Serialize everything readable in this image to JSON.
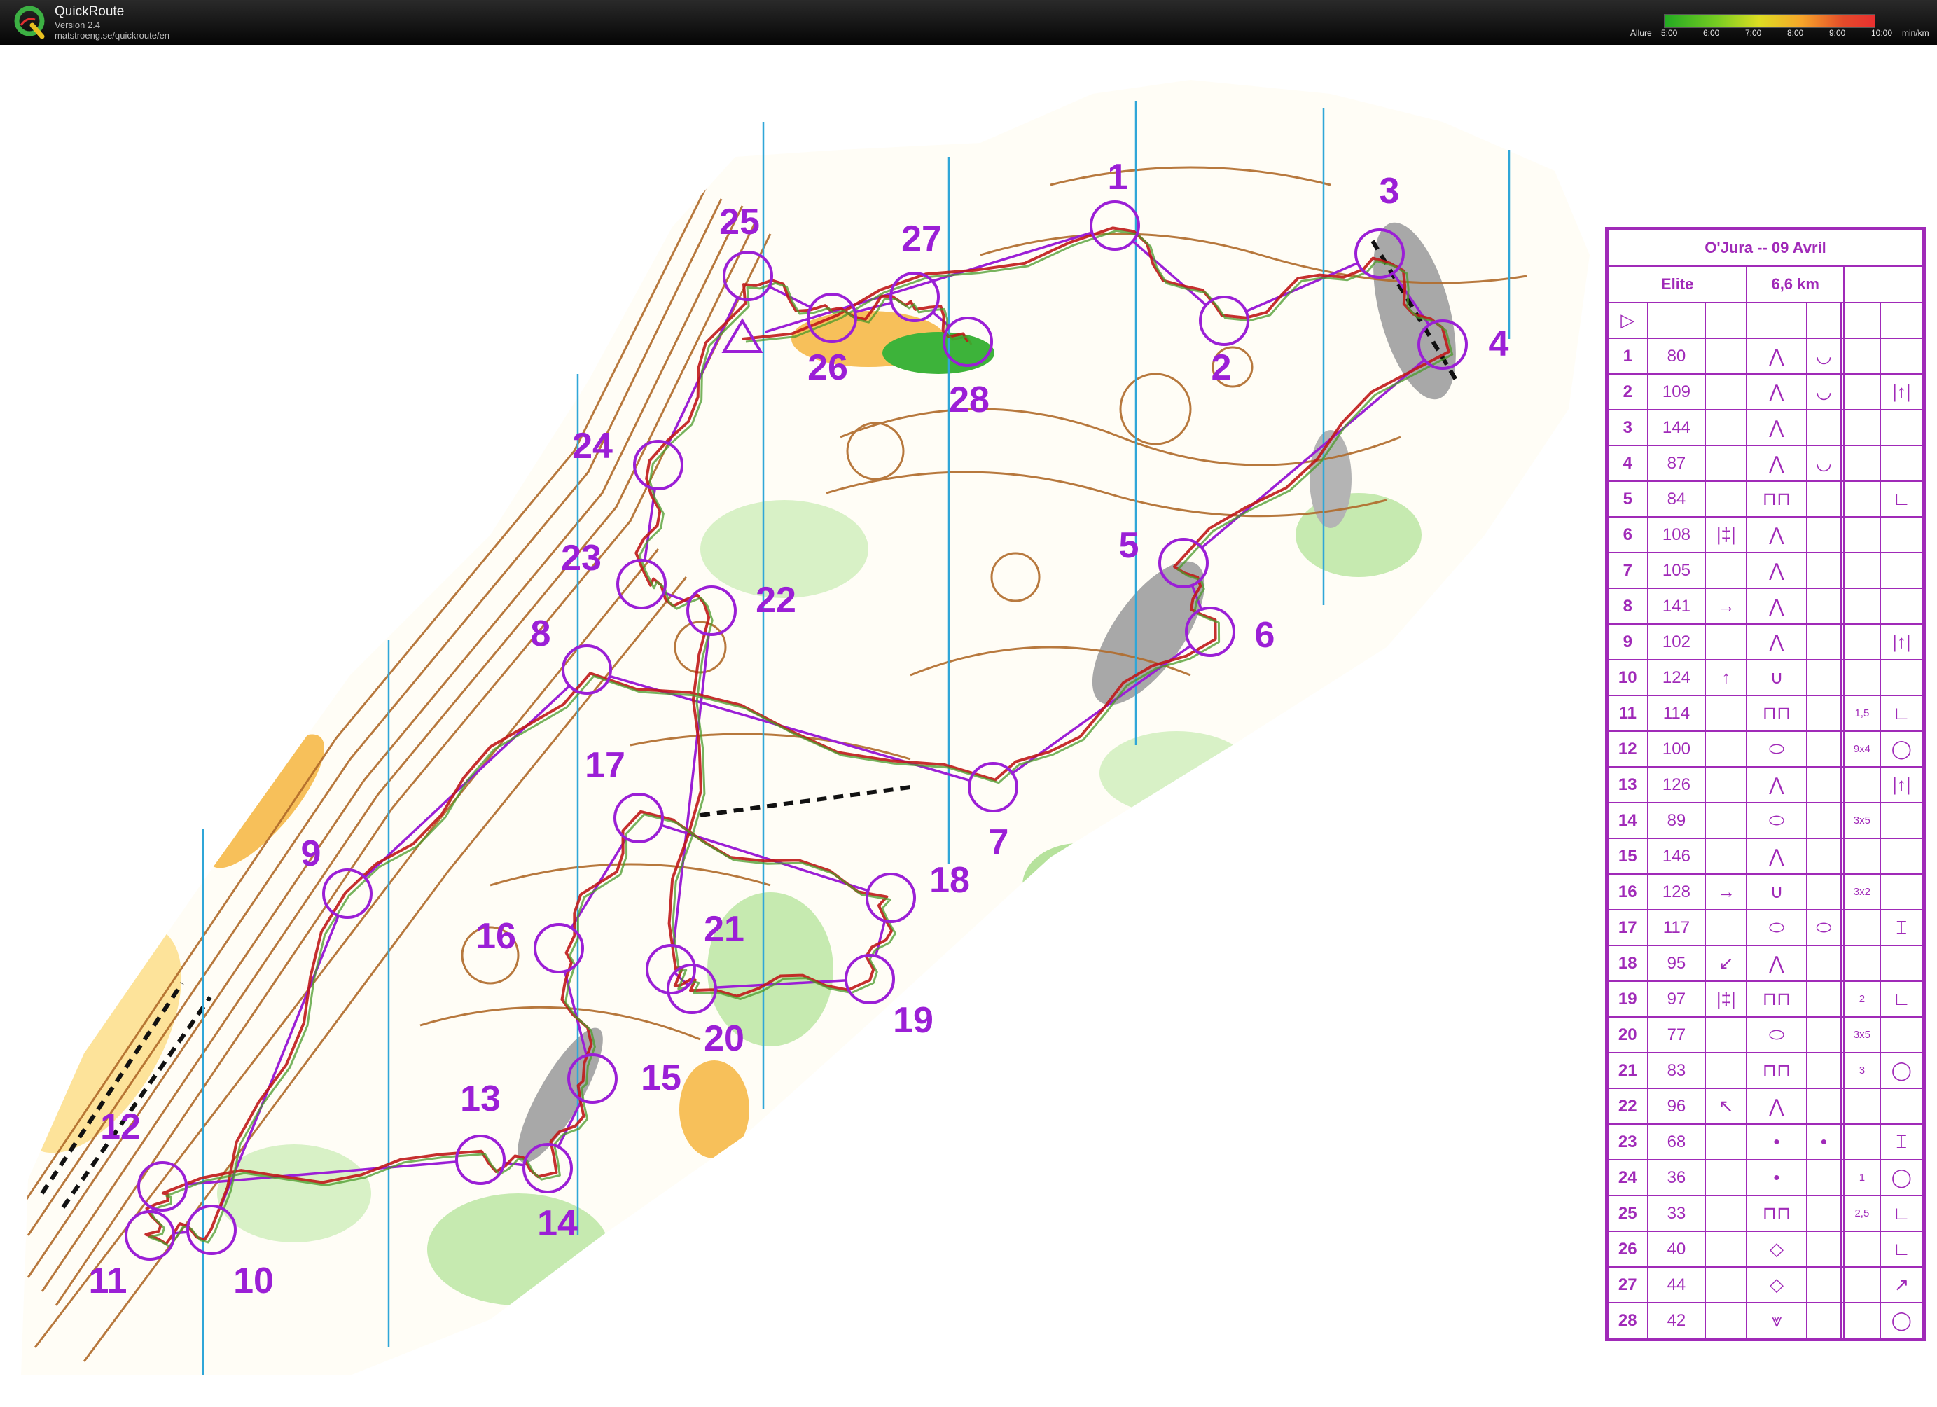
{
  "app": {
    "name": "QuickRoute",
    "version": "Version 2.4",
    "url": "matstroeng.se/quickroute/en",
    "logo_letter": "Q",
    "logo_icon": "quickroute-logo-icon"
  },
  "pace_legend": {
    "label": "Allure",
    "ticks": [
      "5:00",
      "6:00",
      "7:00",
      "8:00",
      "9:00",
      "10:00"
    ],
    "unit": "min/km",
    "colors": [
      "#22aa22",
      "#77cc22",
      "#dddd22",
      "#f6a62a",
      "#e44b2a",
      "#e83030"
    ]
  },
  "colors": {
    "course": "#9b1fd6",
    "route": "#c01818",
    "terrain_open": "#fde39a",
    "terrain_green": "#9bd67a",
    "contour": "#b06a2a",
    "rock": "#9a9a9a",
    "grid": "#2fa6d8"
  },
  "controls": [
    {
      "n": "1"
    },
    {
      "n": "2"
    },
    {
      "n": "3"
    },
    {
      "n": "4"
    },
    {
      "n": "5"
    },
    {
      "n": "6"
    },
    {
      "n": "7"
    },
    {
      "n": "8"
    },
    {
      "n": "9"
    },
    {
      "n": "10"
    },
    {
      "n": "11"
    },
    {
      "n": "12"
    },
    {
      "n": "13"
    },
    {
      "n": "14"
    },
    {
      "n": "15"
    },
    {
      "n": "16"
    },
    {
      "n": "17"
    },
    {
      "n": "18"
    },
    {
      "n": "19"
    },
    {
      "n": "20"
    },
    {
      "n": "21"
    },
    {
      "n": "22"
    },
    {
      "n": "23"
    },
    {
      "n": "24"
    },
    {
      "n": "25"
    },
    {
      "n": "26"
    },
    {
      "n": "27"
    },
    {
      "n": "28"
    }
  ],
  "description_sheet": {
    "title": "O'Jura -- 09 Avril",
    "category": "Elite",
    "distance": "6,6 km",
    "start_symbol": "▷",
    "rows": [
      {
        "n": "1",
        "code": "80",
        "c": "",
        "d": "⋀",
        "e": "◡",
        "f": "",
        "g": ""
      },
      {
        "n": "2",
        "code": "109",
        "c": "",
        "d": "⋀",
        "e": "◡",
        "f": "",
        "g": "|↑|"
      },
      {
        "n": "3",
        "code": "144",
        "c": "",
        "d": "⋀",
        "e": "",
        "f": "",
        "g": ""
      },
      {
        "n": "4",
        "code": "87",
        "c": "",
        "d": "⋀",
        "e": "◡",
        "f": "",
        "g": ""
      },
      {
        "n": "5",
        "code": "84",
        "c": "",
        "d": "⊓⊓",
        "e": "",
        "f": "",
        "g": "∟"
      },
      {
        "n": "6",
        "code": "108",
        "c": "|‡|",
        "d": "⋀",
        "e": "",
        "f": "",
        "g": ""
      },
      {
        "n": "7",
        "code": "105",
        "c": "",
        "d": "⋀",
        "e": "",
        "f": "",
        "g": ""
      },
      {
        "n": "8",
        "code": "141",
        "c": "→",
        "d": "⋀",
        "e": "",
        "f": "",
        "g": ""
      },
      {
        "n": "9",
        "code": "102",
        "c": "",
        "d": "⋀",
        "e": "",
        "f": "",
        "g": "|↑|"
      },
      {
        "n": "10",
        "code": "124",
        "c": "↑",
        "d": "∪",
        "e": "",
        "f": "",
        "g": ""
      },
      {
        "n": "11",
        "code": "114",
        "c": "",
        "d": "⊓⊓",
        "e": "",
        "f": "1,5",
        "g": "∟"
      },
      {
        "n": "12",
        "code": "100",
        "c": "",
        "d": "⬭",
        "e": "",
        "f": "9x4",
        "g": "◯"
      },
      {
        "n": "13",
        "code": "126",
        "c": "",
        "d": "⋀",
        "e": "",
        "f": "",
        "g": "|↑|"
      },
      {
        "n": "14",
        "code": "89",
        "c": "",
        "d": "⬭",
        "e": "",
        "f": "3x5",
        "g": ""
      },
      {
        "n": "15",
        "code": "146",
        "c": "",
        "d": "⋀",
        "e": "",
        "f": "",
        "g": ""
      },
      {
        "n": "16",
        "code": "128",
        "c": "→",
        "d": "∪",
        "e": "",
        "f": "3x2",
        "g": ""
      },
      {
        "n": "17",
        "code": "117",
        "c": "",
        "d": "⬭",
        "e": "⬭",
        "f": "",
        "g": "⌶"
      },
      {
        "n": "18",
        "code": "95",
        "c": "↙",
        "d": "⋀",
        "e": "",
        "f": "",
        "g": ""
      },
      {
        "n": "19",
        "code": "97",
        "c": "|‡|",
        "d": "⊓⊓",
        "e": "",
        "f": "2",
        "g": "∟"
      },
      {
        "n": "20",
        "code": "77",
        "c": "",
        "d": "⬭",
        "e": "",
        "f": "3x5",
        "g": ""
      },
      {
        "n": "21",
        "code": "83",
        "c": "",
        "d": "⊓⊓",
        "e": "",
        "f": "3",
        "g": "◯"
      },
      {
        "n": "22",
        "code": "96",
        "c": "↖",
        "d": "⋀",
        "e": "",
        "f": "",
        "g": ""
      },
      {
        "n": "23",
        "code": "68",
        "c": "",
        "d": "•",
        "e": "•",
        "f": "",
        "g": "⌶"
      },
      {
        "n": "24",
        "code": "36",
        "c": "",
        "d": "•",
        "e": "",
        "f": "1",
        "g": "◯"
      },
      {
        "n": "25",
        "code": "33",
        "c": "",
        "d": "⊓⊓",
        "e": "",
        "f": "2,5",
        "g": "∟"
      },
      {
        "n": "26",
        "code": "40",
        "c": "",
        "d": "◇",
        "e": "",
        "f": "",
        "g": "∟"
      },
      {
        "n": "27",
        "code": "44",
        "c": "",
        "d": "◇",
        "e": "",
        "f": "",
        "g": "↗"
      },
      {
        "n": "28",
        "code": "42",
        "c": "",
        "d": "⩔",
        "e": "",
        "f": "",
        "g": "◯"
      }
    ]
  }
}
